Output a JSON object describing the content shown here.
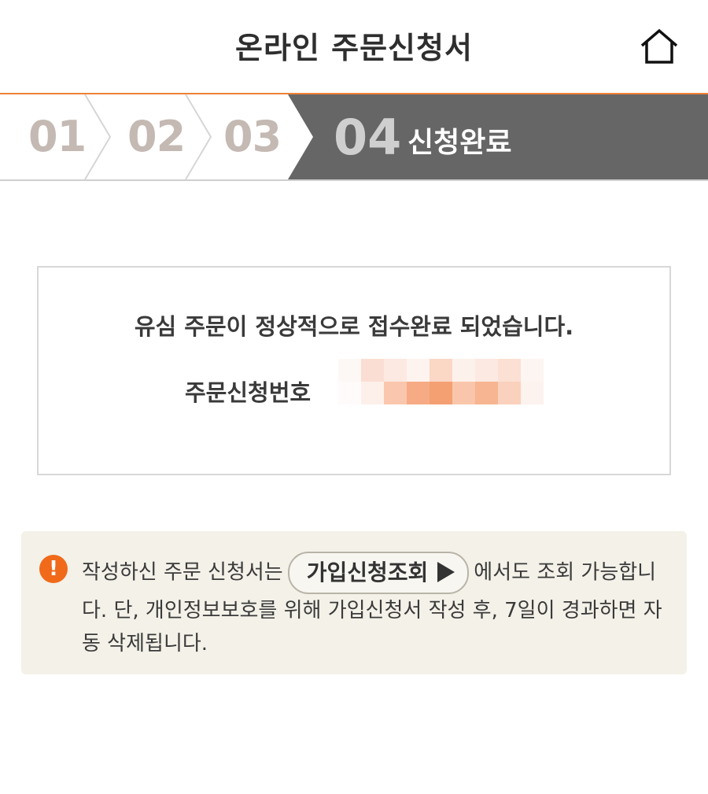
{
  "header": {
    "title": "온라인 주문신청서",
    "home_icon": "home-icon"
  },
  "steps": {
    "items": [
      {
        "number": "01"
      },
      {
        "number": "02"
      },
      {
        "number": "03"
      }
    ],
    "active": {
      "number": "04",
      "label": "신청완료"
    },
    "colors": {
      "accent_border": "#f08237",
      "active_bg": "#666666",
      "inactive_text": "#c4b9b3"
    }
  },
  "result": {
    "message": "유심 주문이 정상적으로 접수완료 되었습니다.",
    "order_number_label": "주문신청번호"
  },
  "notice": {
    "icon": "exclamation-icon",
    "text_before": "작성하신 주문 신청서는",
    "button_label": "가입신청조회",
    "text_after": "에서도 조회 가능합니다. 단, 개인정보보호를 위해 가입신청서 작성 후, 7일이 경과하면 자동 삭제됩니다."
  }
}
